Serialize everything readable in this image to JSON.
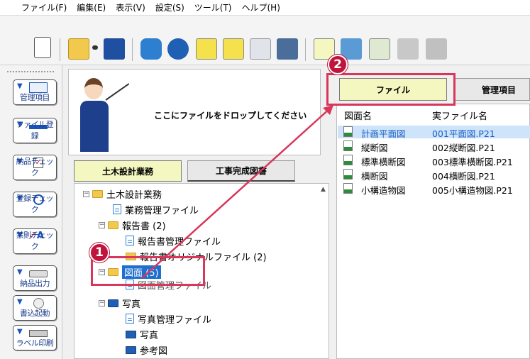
{
  "menu": [
    "ファイル(F)",
    "編集(E)",
    "表示(V)",
    "設定(S)",
    "ツール(T)",
    "ヘルプ(H)"
  ],
  "sidebar": [
    {
      "label": "管理項目",
      "icon": "list-icon"
    },
    {
      "label": "ファイル登録",
      "icon": "file-add-icon"
    },
    {
      "label": "納品チェック",
      "icon": "checkbox-icon"
    },
    {
      "label": "登録チェック",
      "icon": "magnifier-icon"
    },
    {
      "label": "禁則チェック",
      "icon": "forbidden-check-icon"
    },
    {
      "label": "納品出力",
      "icon": "drive-icon"
    },
    {
      "label": "書込起動",
      "icon": "disc-icon"
    },
    {
      "label": "ラベル印刷",
      "icon": "printer-icon"
    }
  ],
  "drop_area": {
    "text": "ここにファイルをドロップしてください"
  },
  "left_tabs": {
    "active": "土木設計業務",
    "other": "工事完成図書"
  },
  "tree": {
    "root": "土木設計業務",
    "business_file": "業務管理ファイル",
    "report": "報告書 (2)",
    "report_file": "報告書管理ファイル",
    "report_original": "報告書オリジナルファイル (2)",
    "drawing": "図面 (5)",
    "drawing_file": "図面管理ファイル",
    "photo": "写真",
    "photo_file": "写真管理ファイル",
    "photo_sub": "写真",
    "reference": "参考図"
  },
  "right_tabs": {
    "active": "ファイル",
    "other": "管理項目"
  },
  "file_list": {
    "headers": {
      "name": "図面名",
      "file": "実ファイル名"
    },
    "rows": [
      {
        "name": "計画平面図",
        "file": "001平面図.P21",
        "selected": true
      },
      {
        "name": "縦断図",
        "file": "002縦断図.P21",
        "selected": false
      },
      {
        "name": "標準横断図",
        "file": "003標準横断図.P21",
        "selected": false
      },
      {
        "name": "横断図",
        "file": "004横断図.P21",
        "selected": false
      },
      {
        "name": "小構造物図",
        "file": "005小構造物図.P21",
        "selected": false
      }
    ]
  },
  "annotations": {
    "step1": "1",
    "step2": "2"
  },
  "colors": {
    "accent_red": "#d8365b",
    "badge": "#c0143c",
    "tab_active": "#f4f7c0",
    "selection": "#1f6fd0"
  }
}
